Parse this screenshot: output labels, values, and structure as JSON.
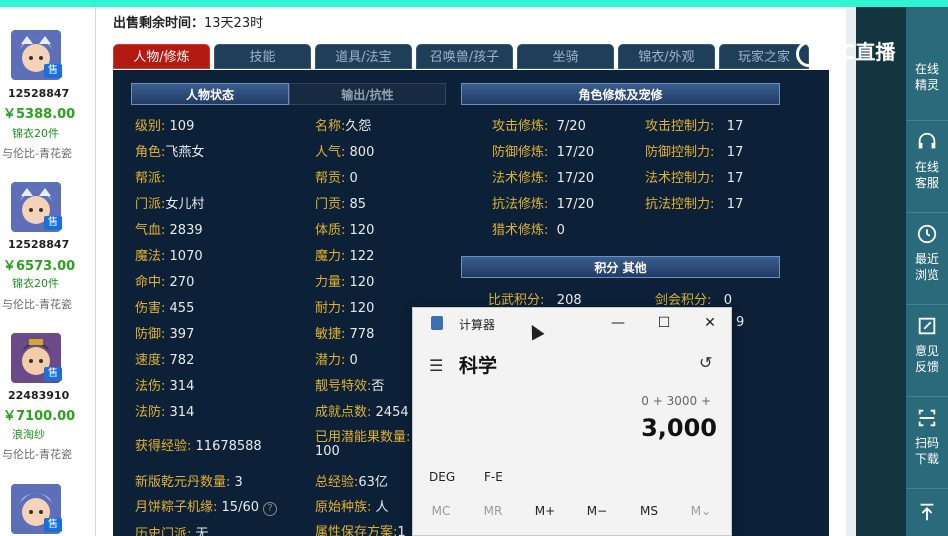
{
  "listings": [
    {
      "id": "12528847",
      "price": "￥5388.00",
      "tag": "锦衣20件",
      "server": "与伦比-青花瓷",
      "badge": "售"
    },
    {
      "id": "12528847",
      "price": "￥6573.00",
      "tag": "锦衣20件",
      "server": "与伦比-青花瓷",
      "badge": "售"
    },
    {
      "id": "22483910",
      "price": "￥7100.00",
      "tag": "浪淘纱",
      "server": "与伦比-青花瓷",
      "badge": "售"
    },
    {
      "badge": "售"
    }
  ],
  "sale": {
    "label": "出售剩余时间：",
    "value": "13天23时"
  },
  "tabs": [
    "人物/修炼",
    "技能",
    "道具/法宝",
    "召唤兽/孩子",
    "坐骑",
    "锦衣/外观",
    "玩家之家"
  ],
  "panel_headers": {
    "status": "人物状态",
    "output": "输出/抗性",
    "cultivation": "角色修炼及宠修",
    "points": "积分 其他"
  },
  "stats_left": [
    {
      "k": "级别:",
      "v": "109"
    },
    {
      "k": "角色:",
      "v": "飞燕女"
    },
    {
      "k": "帮派:",
      "v": ""
    },
    {
      "k": "门派:",
      "v": "女儿村"
    },
    {
      "k": "气血:",
      "v": "2839"
    },
    {
      "k": "魔法:",
      "v": "1070"
    },
    {
      "k": "命中:",
      "v": "270"
    },
    {
      "k": "伤害:",
      "v": "455"
    },
    {
      "k": "防御:",
      "v": "397"
    },
    {
      "k": "速度:",
      "v": "782"
    },
    {
      "k": "法伤:",
      "v": "314"
    },
    {
      "k": "法防:",
      "v": "314"
    }
  ],
  "stats_right": [
    {
      "k": "名称:",
      "v": "久怨"
    },
    {
      "k": "人气:",
      "v": "800"
    },
    {
      "k": "帮贡:",
      "v": "0"
    },
    {
      "k": "门贡:",
      "v": "85"
    },
    {
      "k": "体质:",
      "v": "120"
    },
    {
      "k": "魔力:",
      "v": "122"
    },
    {
      "k": "力量:",
      "v": "120"
    },
    {
      "k": "耐力:",
      "v": "120"
    },
    {
      "k": "敏捷:",
      "v": "778"
    },
    {
      "k": "潜力:",
      "v": "0"
    },
    {
      "k": "靓号特效:",
      "v": "否"
    },
    {
      "k": "成就点数:",
      "v": "2454"
    }
  ],
  "stats_extra": {
    "exp": {
      "k": "获得经验:",
      "v": "11678588"
    },
    "potion": {
      "k": "已用潜能果数量:",
      "v": "100"
    },
    "qiankun": {
      "k": "新版乾元丹数量:",
      "v": "3"
    },
    "total_exp": {
      "k": "总经验:",
      "v": "63亿"
    },
    "mooncake": {
      "k": "月饼粽子机缘:",
      "v": "15/60"
    },
    "race": {
      "k": "原始种族:",
      "v": "人"
    },
    "history": {
      "k": "历史门派:",
      "v": "无"
    },
    "attr_plan": {
      "k": "属性保存方案:",
      "v": "1"
    }
  },
  "cultivation": [
    {
      "k": "攻击修炼:",
      "v": "7/20",
      "k2": "攻击控制力:",
      "v2": "17"
    },
    {
      "k": "防御修炼:",
      "v": "17/20",
      "k2": "防御控制力:",
      "v2": "17"
    },
    {
      "k": "法术修炼:",
      "v": "17/20",
      "k2": "法术控制力:",
      "v2": "17"
    },
    {
      "k": "抗法修炼:",
      "v": "17/20",
      "k2": "抗法控制力:",
      "v2": "17"
    },
    {
      "k": "猎术修炼:",
      "v": "0"
    }
  ],
  "points": {
    "k": "比武积分:",
    "v": "208",
    "k2": "剑会积分:",
    "v2": "0",
    "v3": "9"
  },
  "stream": {
    "logo": "CC直播"
  },
  "rside": [
    {
      "label1": "在线",
      "label2": "精灵"
    },
    {
      "label1": "在线",
      "label2": "客服"
    },
    {
      "label1": "最近",
      "label2": "浏览"
    },
    {
      "label1": "意见",
      "label2": "反馈"
    },
    {
      "label1": "扫码",
      "label2": "下载"
    }
  ],
  "calc": {
    "title": "计算器",
    "mode": "科学",
    "expression": "0 + 3000 +",
    "display": "3,000",
    "deg": "DEG",
    "fe": "F-E",
    "memory": [
      "MC",
      "MR",
      "M+",
      "M−",
      "MS",
      "M⌄"
    ]
  }
}
